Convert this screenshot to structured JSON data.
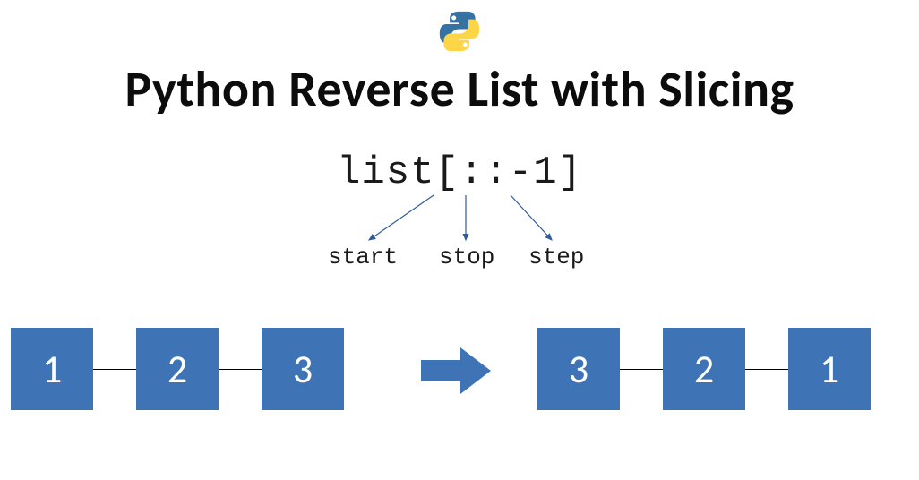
{
  "title": "Python Reverse List with Slicing",
  "code": "list[::-1]",
  "labels": {
    "start": "start",
    "stop": "stop",
    "step": "step"
  },
  "left_list": [
    "1",
    "2",
    "3"
  ],
  "right_list": [
    "3",
    "2",
    "1"
  ],
  "colors": {
    "box": "#3e74b6",
    "arrow": "#3e74b6",
    "pointer": "#2f5b9a"
  }
}
